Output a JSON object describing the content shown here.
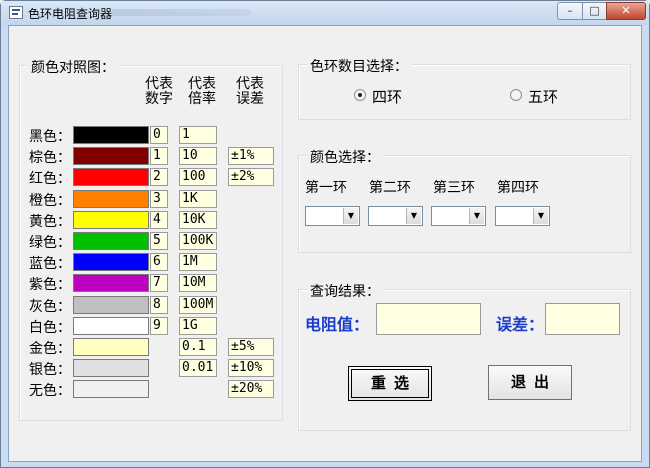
{
  "window": {
    "title": "色环电阻查询器",
    "controls": {
      "minimize": "–",
      "maximize": "□",
      "close": "✕"
    }
  },
  "chart_group": {
    "title": "颜色对照图：",
    "headers": {
      "digit": "代表\n数字",
      "multiplier": "代表\n倍率",
      "tolerance": "代表\n误差"
    },
    "rows": [
      {
        "label": "黑色：",
        "color": "#000000",
        "digit": "0",
        "multiplier": "1",
        "tolerance": ""
      },
      {
        "label": "棕色：",
        "color": "#800000",
        "digit": "1",
        "multiplier": "10",
        "tolerance": "±1%"
      },
      {
        "label": "红色：",
        "color": "#ff0000",
        "digit": "2",
        "multiplier": "100",
        "tolerance": "±2%"
      },
      {
        "label": "橙色：",
        "color": "#ff8000",
        "digit": "3",
        "multiplier": "1K",
        "tolerance": ""
      },
      {
        "label": "黄色：",
        "color": "#ffff00",
        "digit": "4",
        "multiplier": "10K",
        "tolerance": ""
      },
      {
        "label": "绿色：",
        "color": "#00c000",
        "digit": "5",
        "multiplier": "100K",
        "tolerance": ""
      },
      {
        "label": "蓝色：",
        "color": "#0000ff",
        "digit": "6",
        "multiplier": "1M",
        "tolerance": ""
      },
      {
        "label": "紫色：",
        "color": "#c000c0",
        "digit": "7",
        "multiplier": "10M",
        "tolerance": ""
      },
      {
        "label": "灰色：",
        "color": "#c0c0c0",
        "digit": "8",
        "multiplier": "100M",
        "tolerance": ""
      },
      {
        "label": "白色：",
        "color": "#ffffff",
        "digit": "9",
        "multiplier": "1G",
        "tolerance": ""
      },
      {
        "label": "金色：",
        "color": "#ffffc0",
        "digit": "",
        "multiplier": "0.1",
        "tolerance": "±5%"
      },
      {
        "label": "银色：",
        "color": "#e0e0e0",
        "digit": "",
        "multiplier": "0.01",
        "tolerance": "±10%"
      },
      {
        "label": "无色：",
        "color": "#f0f0f0",
        "digit": "",
        "multiplier": "",
        "tolerance": "±20%"
      }
    ]
  },
  "ring_count_group": {
    "title": "色环数目选择：",
    "options": [
      {
        "label": "四环",
        "checked": true
      },
      {
        "label": "五环",
        "checked": false
      }
    ]
  },
  "color_select_group": {
    "title": "颜色选择：",
    "rings": [
      {
        "label": "第一环",
        "value": ""
      },
      {
        "label": "第二环",
        "value": ""
      },
      {
        "label": "第三环",
        "value": ""
      },
      {
        "label": "第四环",
        "value": ""
      }
    ]
  },
  "result_group": {
    "title": "查询结果：",
    "resistance_label": "电阻值：",
    "resistance_value": "",
    "tolerance_label": "误差：",
    "tolerance_value": ""
  },
  "buttons": {
    "reset": "重选",
    "exit": "退出"
  },
  "colors": {
    "accent_blue": "#1a3cc8",
    "field_bg": "#ffffe1"
  }
}
